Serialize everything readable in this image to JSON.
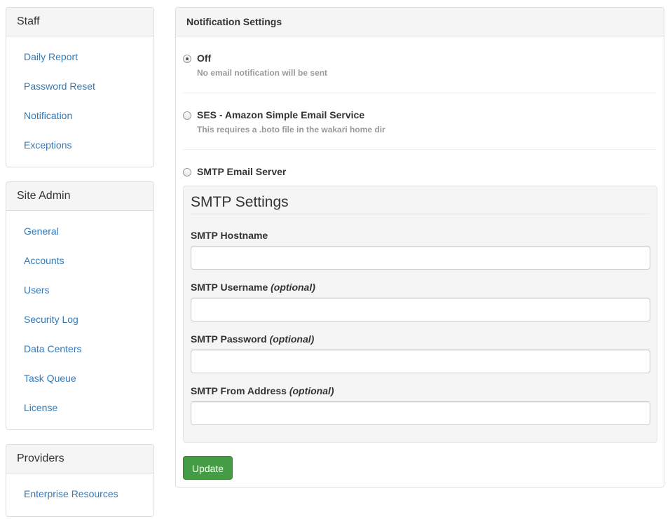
{
  "sidebar": {
    "staff": {
      "title": "Staff",
      "items": [
        "Daily Report",
        "Password Reset",
        "Notification",
        "Exceptions"
      ]
    },
    "site_admin": {
      "title": "Site Admin",
      "items": [
        "General",
        "Accounts",
        "Users",
        "Security Log",
        "Data Centers",
        "Task Queue",
        "License"
      ]
    },
    "providers": {
      "title": "Providers",
      "items": [
        "Enterprise Resources"
      ]
    }
  },
  "main": {
    "title": "Notification Settings",
    "options": [
      {
        "label": "Off",
        "help": "No email notification will be sent",
        "checked": true
      },
      {
        "label": "SES - Amazon Simple Email Service",
        "help": "This requires a .boto file in the wakari home dir",
        "checked": false
      },
      {
        "label": "SMTP Email Server",
        "help": "",
        "checked": false
      }
    ],
    "smtp": {
      "title": "SMTP Settings",
      "fields": [
        {
          "label": "SMTP Hostname",
          "optional": "",
          "value": ""
        },
        {
          "label": "SMTP Username",
          "optional": "(optional)",
          "value": ""
        },
        {
          "label": "SMTP Password",
          "optional": "(optional)",
          "value": ""
        },
        {
          "label": "SMTP From Address",
          "optional": "(optional)",
          "value": ""
        }
      ]
    },
    "update_label": "Update"
  },
  "colors": {
    "link": "#337ab7",
    "success": "#449d44",
    "panel_heading": "#f5f5f5",
    "border": "#dddddd"
  }
}
